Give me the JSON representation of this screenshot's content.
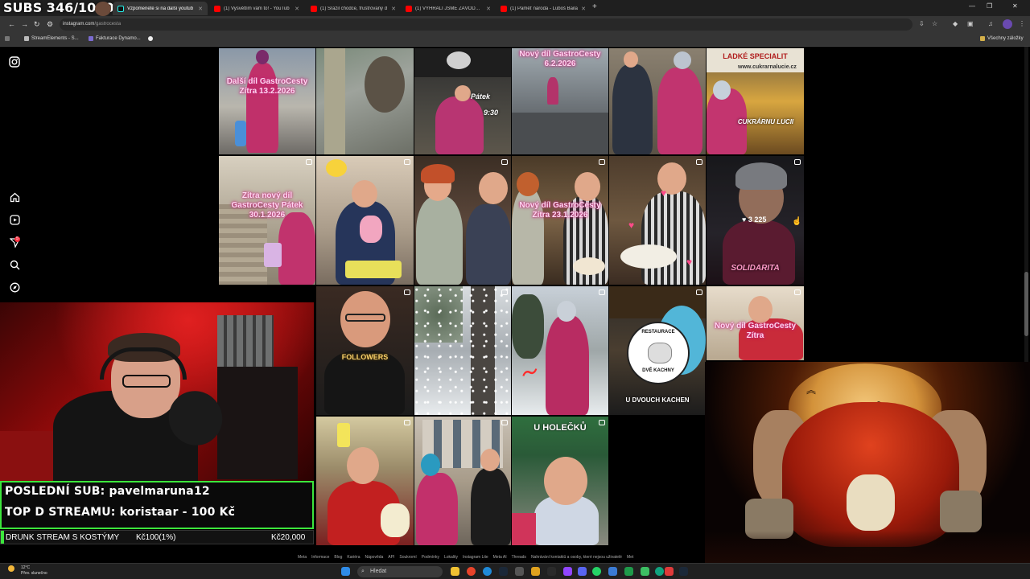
{
  "browser": {
    "tabs": [
      {
        "label": "Vzpomenete si na další youtub",
        "kind": "tiktok"
      },
      {
        "label": "(1) Vysvětlím vám to! - YouTub",
        "kind": "youtube"
      },
      {
        "label": "(1) Srazil chodce, frustrovaný d",
        "kind": "youtube"
      },
      {
        "label": "(1) VYHRÁLI JSME ZÁVODY NA",
        "kind": "youtube"
      },
      {
        "label": "(1) Paměť národa - Luboš Baila",
        "kind": "youtube"
      }
    ],
    "new_tab": "+",
    "url_host": "instagram.com",
    "url_path": "/gastrocesta",
    "bookmarks": [
      "StreamElements - S...",
      "Fakturace Dynamo..."
    ],
    "all_bookmarks": "Všechny záložky"
  },
  "stream": {
    "subs_counter": "SUBS 346/1000",
    "last_sub": "POSLEDNÍ SUB: pavelmaruna12",
    "top_donor": "TOP D STREAMU: koristaar - 100 Kč",
    "goal_name": "DRUNK STREAM S KOSTÝMY",
    "goal_progress": "Kč100(1%)",
    "goal_target": "Kč20,000",
    "goal_fraction": 0.01
  },
  "grid": {
    "captions": {
      "r1c1": "Další díl GastroCesty Zítra 13.2.2026",
      "r1c3a": "Pátek",
      "r1c3b": "9:30",
      "r1c4": "Nový díl GastroCesty 6.2.2026",
      "r1c6a": "LADKÉ SPECIALIT",
      "r1c6b": "www.cukrarnalucie.cz",
      "r1c6c": "CUKRÁRNU LUCII",
      "r2c1": "Zítra nový díl GastroCesty Pátek 30.1.2026",
      "r2c4": "Nový díl GastroCesty Zítra 23.1.2026",
      "r2c6": "SOLIDARITA",
      "r3c2": "FOLLOWERS",
      "r3c5a": "RESTAURACE",
      "r3c5b": "DVĚ KACHNY",
      "r3c5c": "U DVOUCH KACHEN",
      "r3c6": "Nový díl GastroCesty Zítra",
      "r4c3": "U HOLEČKŮ"
    },
    "hover_likes": "3 225"
  },
  "footer_links": [
    "Meta",
    "Informace",
    "Blog",
    "Kariéra",
    "Nápověda",
    "API",
    "Soukromí",
    "Podmínky",
    "Lokality",
    "Instagram Lite",
    "Meta AI",
    "Threads",
    "Nahrávání kontaktů a osoby, které nejsou uživatelé",
    "Met"
  ],
  "taskbar": {
    "temp": "12°C",
    "weather": "Přev. slunečno",
    "search": "Hledat"
  },
  "colors": {
    "goal_fill": "#3ce63c",
    "banner_border": "#3ce63c",
    "instagram_bg": "#000000"
  }
}
